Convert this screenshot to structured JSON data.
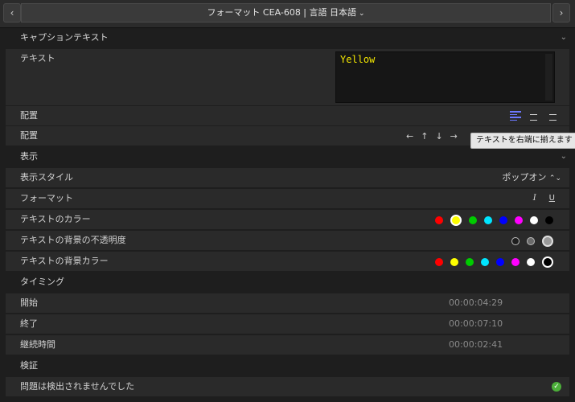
{
  "header": {
    "prev_icon": "chevron-left-icon",
    "next_icon": "chevron-right-icon",
    "title": "フォーマット CEA-608 | 言語 日本語",
    "title_chevron": "chevron-down-icon"
  },
  "caption_text_section": {
    "label": "キャプションテキスト",
    "text_row": {
      "label": "テキスト",
      "value": "Yellow"
    },
    "alignment_row": {
      "label": "配置",
      "buttons": [
        "align-left-icon",
        "align-center-icon",
        "align-right-icon"
      ],
      "active": "align-left-icon"
    },
    "placement_row": {
      "label": "配置",
      "arrows": [
        "←",
        "↑",
        "↓",
        "→"
      ],
      "tooltip": "テキストを右端に揃えます"
    }
  },
  "display_section": {
    "label": "表示",
    "style_row": {
      "label": "表示スタイル",
      "value": "ポップオン",
      "chevron": "⌃⌄"
    },
    "format_row": {
      "label": "フォーマット",
      "italic": "I",
      "underline": "U"
    },
    "text_color_row": {
      "label": "テキストのカラー",
      "colors": [
        "#ff0000",
        "#ffff00",
        "#00cc00",
        "#00e5ff",
        "#0000ff",
        "#ff00ff",
        "#ffffff",
        "#000000"
      ],
      "selected_index": 1
    },
    "bg_opacity_row": {
      "label": "テキストの背景の不透明度",
      "options": [
        "#1e1e1e",
        "#6a6a6a",
        "#9a9a9a"
      ],
      "selected_index": 2
    },
    "bg_color_row": {
      "label": "テキストの背景カラー",
      "colors": [
        "#ff0000",
        "#ffff00",
        "#00cc00",
        "#00e5ff",
        "#0000ff",
        "#ff00ff",
        "#ffffff",
        "#000000"
      ],
      "selected_index": 7
    }
  },
  "timing_section": {
    "label": "タイミング",
    "start": {
      "label": "開始",
      "value": "00:00:04:29"
    },
    "end": {
      "label": "終了",
      "value": "00:00:07:10"
    },
    "duration": {
      "label": "継続時間",
      "value": "00:00:02:41"
    }
  },
  "verify_section": {
    "label": "検証",
    "status": {
      "label": "問題は検出されませんでした",
      "icon": "check-circle-icon",
      "color": "#4caf3a"
    }
  }
}
